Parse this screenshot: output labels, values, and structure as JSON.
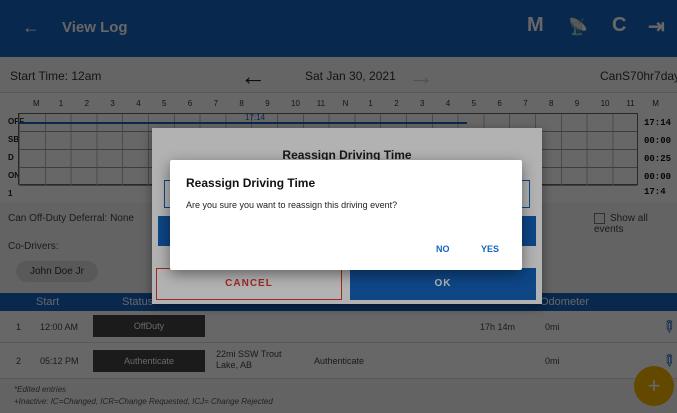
{
  "appbar": {
    "back": "←",
    "title": "View Log",
    "m": "M",
    "antenna": "📡",
    "refresh": "C",
    "logout": "⇥"
  },
  "subbar": {
    "start_time": "Start Time: 12am",
    "prev": "←",
    "date": "Sat Jan 30, 2021",
    "next": "→",
    "cycle": "CanS70hr7days"
  },
  "grid": {
    "hours": [
      "M",
      "1",
      "2",
      "3",
      "4",
      "5",
      "6",
      "7",
      "8",
      "9",
      "10",
      "11",
      "N",
      "1",
      "2",
      "3",
      "4",
      "5",
      "6",
      "7",
      "8",
      "9",
      "10",
      "11",
      "M"
    ],
    "rows": [
      "OFF",
      "SB",
      "D",
      "ON"
    ],
    "totals": [
      "17:14",
      "00:00",
      "00:25",
      "00:00",
      "17:4"
    ],
    "marker": "17:14",
    "row_one": "1"
  },
  "info": {
    "off_duty_deferral": "Can Off-Duty Deferral: None",
    "co_drivers": "Co-Drivers:",
    "co_driver_name": "John Doe Jr",
    "show_all": "Show all events"
  },
  "table": {
    "headers": {
      "start": "Start",
      "status": "Status",
      "odometer": "Odometer"
    },
    "rows": [
      {
        "num": "1",
        "time": "12:00 AM",
        "status": "OffDuty",
        "duration": "17h 14m",
        "odo": "0mi"
      },
      {
        "num": "2",
        "time": "05:12 PM",
        "status": "Authenticate",
        "location": "22mi SSW Trout Lake, AB",
        "note": "Authenticate",
        "odo": "0mi"
      }
    ],
    "footnote1": "*Edited entries",
    "footnote2": "+Inactive: IC=Changed, ICR=Change Requested, ICJ= Change Rejected"
  },
  "fab": "+",
  "dialog_back": {
    "title": "Reassign Driving Time",
    "cancel": "CANCEL",
    "ok": "OK"
  },
  "dialog_front": {
    "title": "Reassign Driving Time",
    "message": "Are you sure you want to reassign this driving event?",
    "no": "NO",
    "yes": "YES"
  }
}
